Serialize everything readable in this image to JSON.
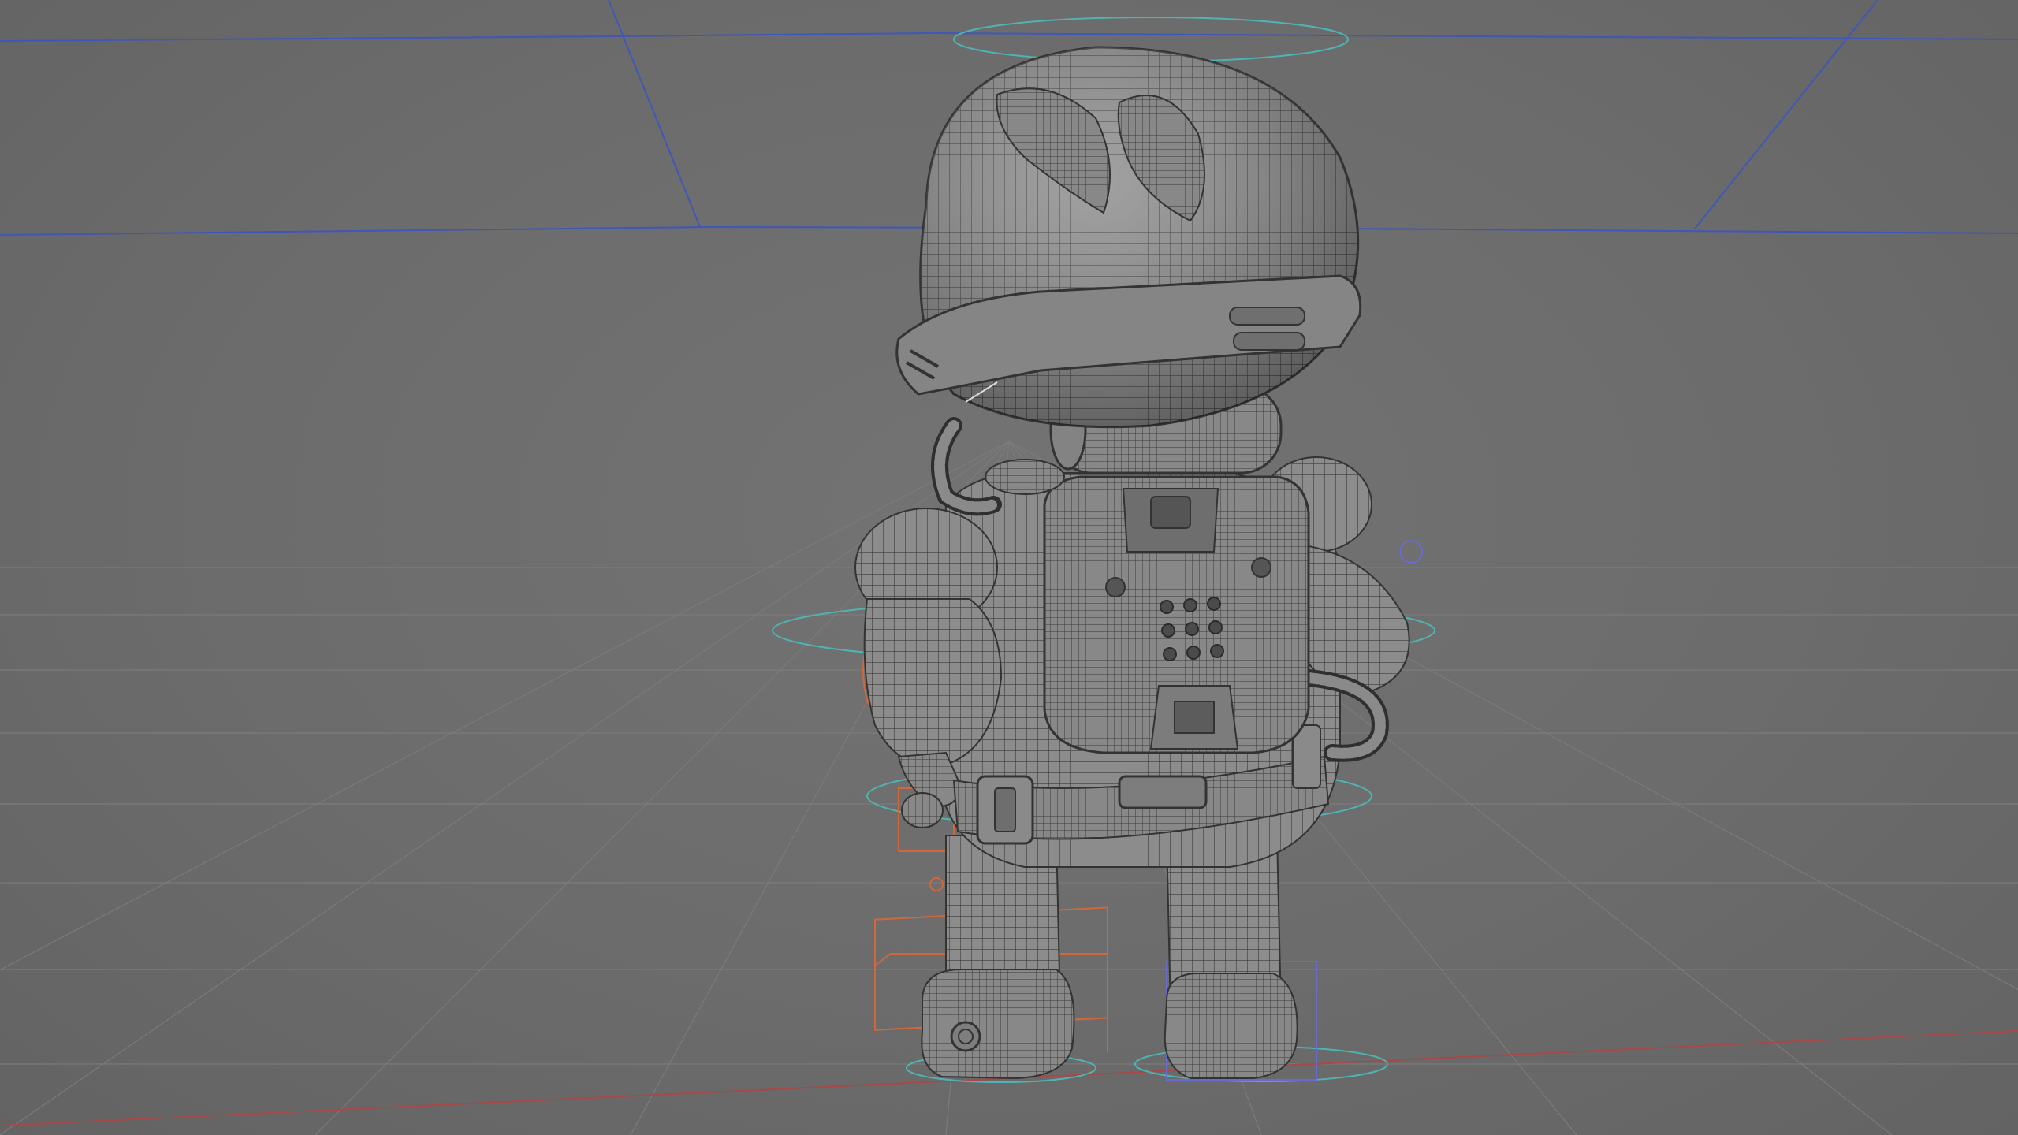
{
  "viewport": {
    "label": "3D viewport",
    "mode": "wireframe-on-shaded",
    "subject": "astronaut-character"
  },
  "colors": {
    "background": "#6b6b6b",
    "floor_grid": "#7a7a7a",
    "bounds_lines": "#3f57b8",
    "axis_x": "#b04a4a",
    "mesh_fill": "#8b8b8b",
    "mesh_wire": "#3a3a3a",
    "rig_left": "#d2683a",
    "rig_right": "#6a6ad0",
    "rig_controls": "#4fb3b3"
  }
}
